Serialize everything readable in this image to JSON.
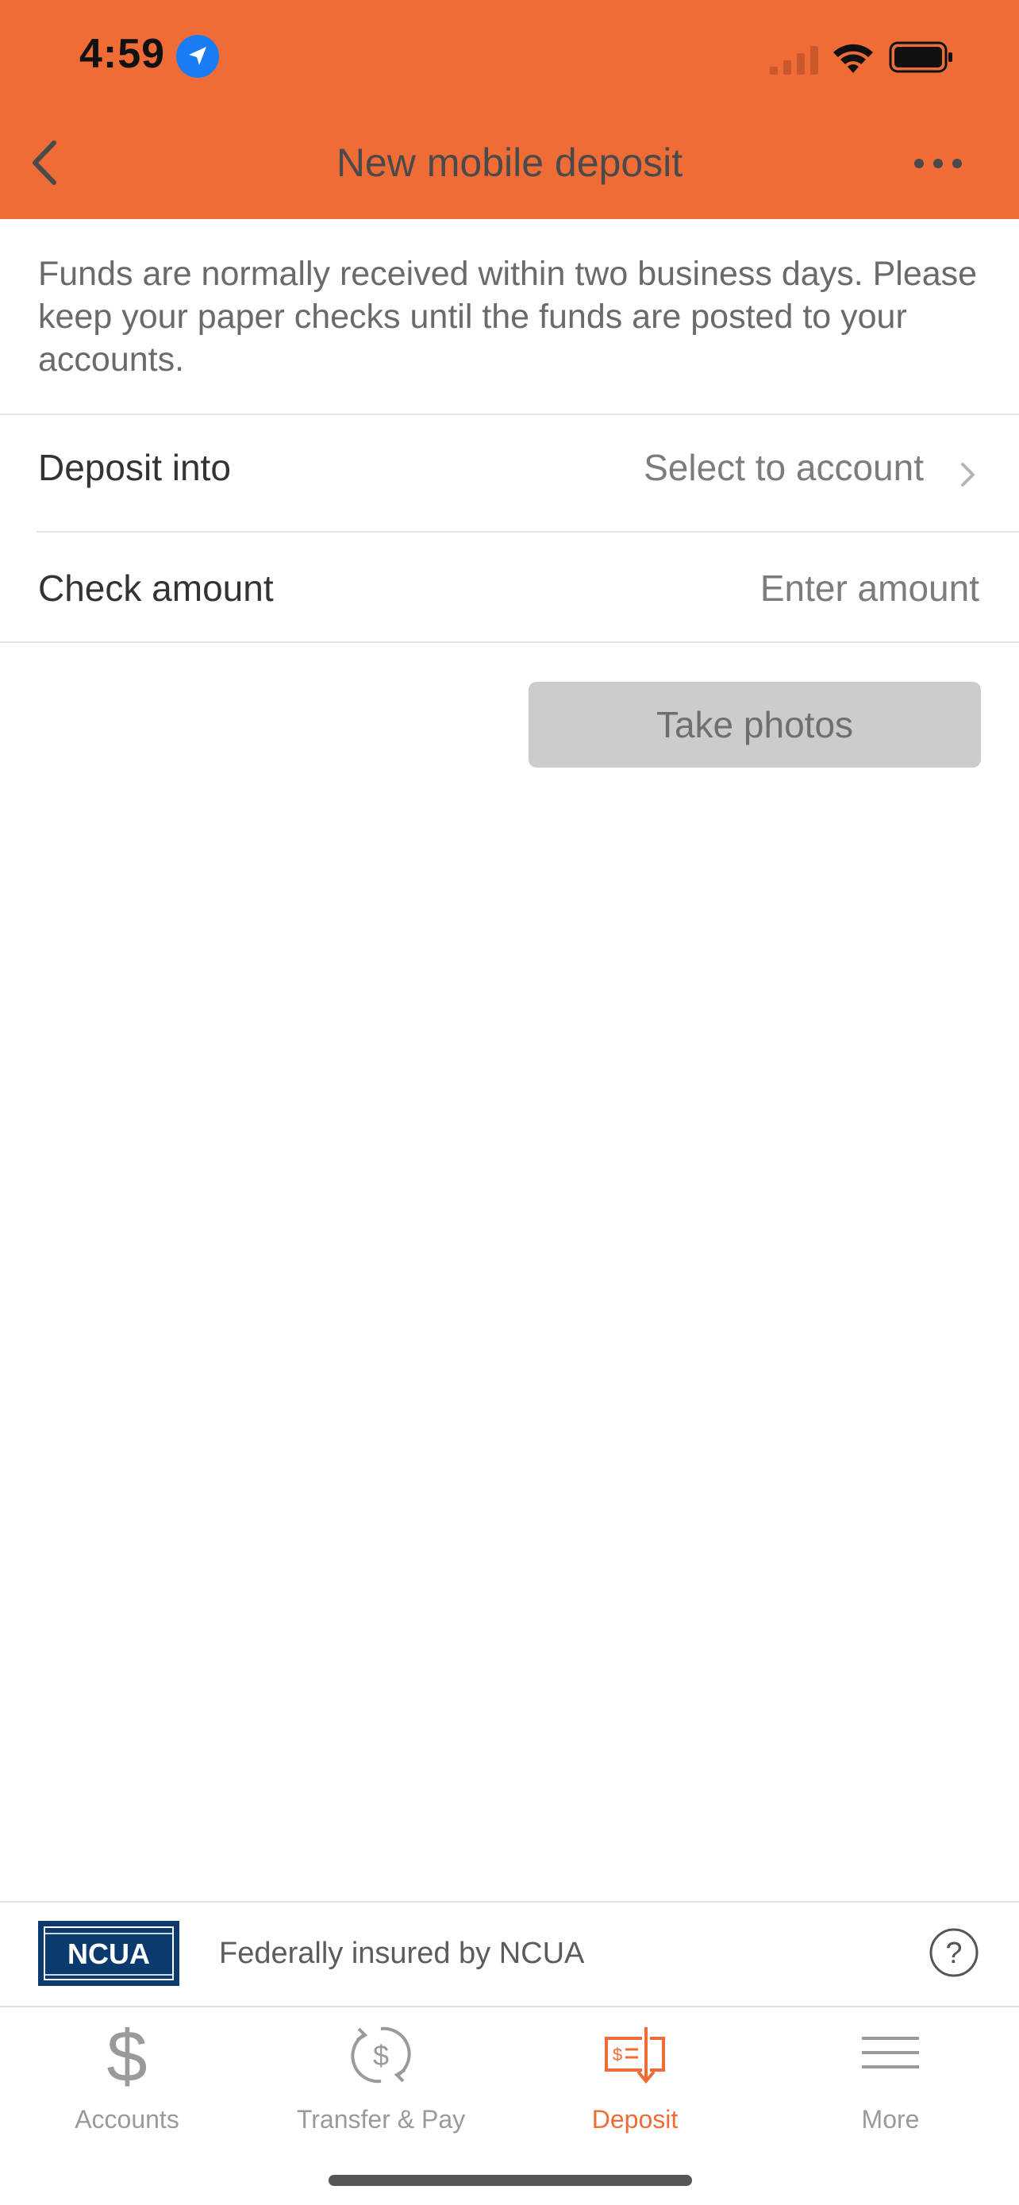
{
  "status_bar": {
    "time": "4:59"
  },
  "header": {
    "title": "New mobile deposit"
  },
  "info_text": "Funds are normally received within two business days. Please keep your paper checks until the funds are posted to your accounts.",
  "form": {
    "deposit_into": {
      "label": "Deposit into",
      "value": "Select to account"
    },
    "check_amount": {
      "label": "Check amount",
      "placeholder": "Enter amount"
    },
    "take_photos_label": "Take photos"
  },
  "footer": {
    "ncua_badge_text": "NCUA",
    "insured_text": "Federally insured by NCUA"
  },
  "tabs": [
    {
      "label": "Accounts",
      "icon": "dollar-icon",
      "active": false
    },
    {
      "label": "Transfer & Pay",
      "icon": "transfer-pay-icon",
      "active": false
    },
    {
      "label": "Deposit",
      "icon": "deposit-check-icon",
      "active": true
    },
    {
      "label": "More",
      "icon": "menu-icon",
      "active": false
    }
  ],
  "colors": {
    "accent": "#F06C37",
    "disabled_button": "#CCCCCC",
    "ncua_blue": "#0B3A6E"
  }
}
